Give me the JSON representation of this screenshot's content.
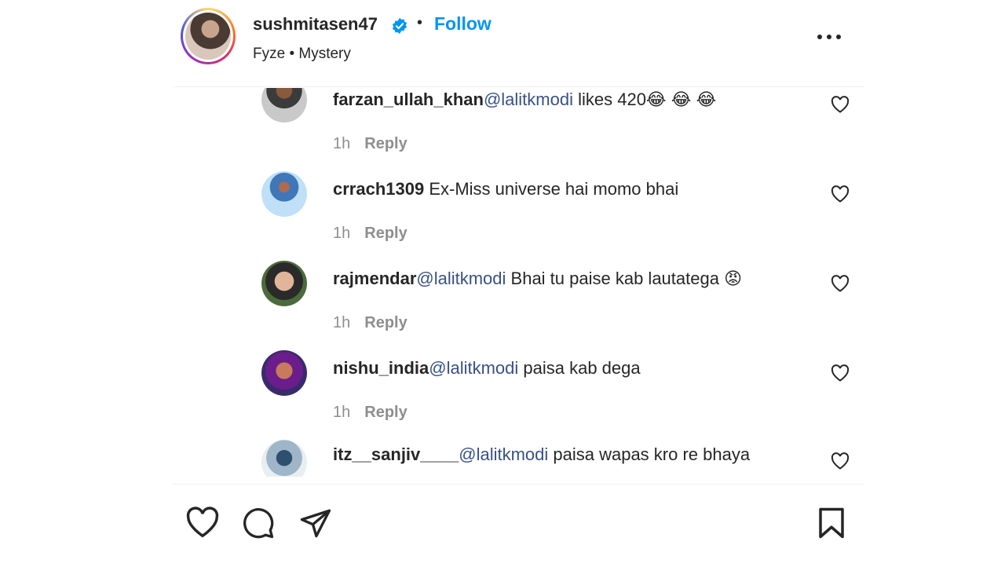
{
  "post_header": {
    "username": "sushmitasen47",
    "separator": "•",
    "follow_label": "Follow",
    "subtitle": "Fyze • Mystery",
    "verified_icon": "verified-badge-icon",
    "more_icon": "more-options-icon"
  },
  "comments": [
    {
      "username": "farzan_ullah_khan",
      "mention": "@lalitkmodi",
      "text": " likes 420😂 😂 😂",
      "time": "1h",
      "reply_label": "Reply"
    },
    {
      "username": "crrach1309",
      "mention": "",
      "text": " Ex-Miss universe hai momo bhai",
      "time": "1h",
      "reply_label": "Reply"
    },
    {
      "username": "rajmendar",
      "mention": "@lalitkmodi",
      "text": " Bhai tu paise kab lautatega 😡",
      "time": "1h",
      "reply_label": "Reply"
    },
    {
      "username": "nishu_india",
      "mention": "@lalitkmodi",
      "text": " paisa kab dega",
      "time": "1h",
      "reply_label": "Reply"
    },
    {
      "username": "itz__sanjiv____",
      "mention": "@lalitkmodi",
      "text": " paisa wapas kro re bhaya",
      "time": "",
      "reply_label": ""
    }
  ],
  "action_bar": {
    "like_icon": "heart-icon",
    "comment_icon": "comment-icon",
    "share_icon": "share-icon",
    "save_icon": "bookmark-icon"
  },
  "colors": {
    "follow_blue": "#0095f6",
    "mention_blue": "#385185",
    "text_dark": "#262626",
    "text_muted": "#8e8e8e"
  }
}
